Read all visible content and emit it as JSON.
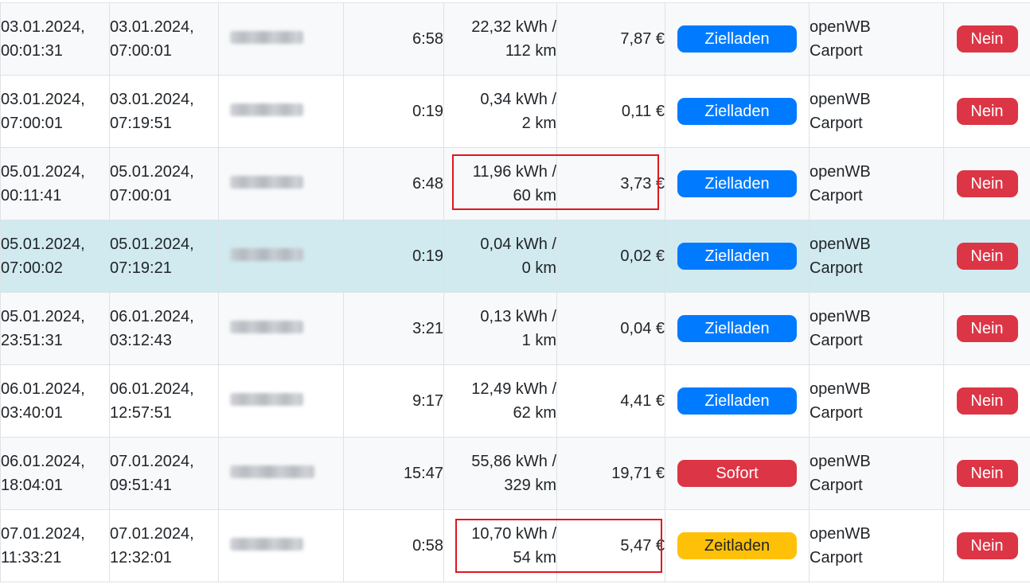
{
  "rows": [
    {
      "start_date": "03.01.2024,",
      "start_time": "00:01:31",
      "end_date": "03.01.2024,",
      "end_time": "07:00:01",
      "duration": "6:58",
      "energy": "22,32 kWh /",
      "range": "112 km",
      "cost": "7,87 €",
      "mode": "Zielladen",
      "mode_color": "#007bff",
      "loc_line1": "openWB",
      "loc_line2": "Carport",
      "flag": "Nein"
    },
    {
      "start_date": "03.01.2024,",
      "start_time": "07:00:01",
      "end_date": "03.01.2024,",
      "end_time": "07:19:51",
      "duration": "0:19",
      "energy": "0,34 kWh /",
      "range": "2 km",
      "cost": "0,11 €",
      "mode": "Zielladen",
      "mode_color": "#007bff",
      "loc_line1": "openWB",
      "loc_line2": "Carport",
      "flag": "Nein"
    },
    {
      "start_date": "05.01.2024,",
      "start_time": "00:11:41",
      "end_date": "05.01.2024,",
      "end_time": "07:00:01",
      "duration": "6:48",
      "energy": "11,96 kWh /",
      "range": "60 km",
      "cost": "3,73 €",
      "mode": "Zielladen",
      "mode_color": "#007bff",
      "loc_line1": "openWB",
      "loc_line2": "Carport",
      "flag": "Nein"
    },
    {
      "start_date": "05.01.2024,",
      "start_time": "07:00:02",
      "end_date": "05.01.2024,",
      "end_time": "07:19:21",
      "duration": "0:19",
      "energy": "0,04 kWh /",
      "range": "0 km",
      "cost": "0,02 €",
      "mode": "Zielladen",
      "mode_color": "#007bff",
      "loc_line1": "openWB",
      "loc_line2": "Carport",
      "flag": "Nein"
    },
    {
      "start_date": "05.01.2024,",
      "start_time": "23:51:31",
      "end_date": "06.01.2024,",
      "end_time": "03:12:43",
      "duration": "3:21",
      "energy": "0,13 kWh /",
      "range": "1 km",
      "cost": "0,04 €",
      "mode": "Zielladen",
      "mode_color": "#007bff",
      "loc_line1": "openWB",
      "loc_line2": "Carport",
      "flag": "Nein"
    },
    {
      "start_date": "06.01.2024,",
      "start_time": "03:40:01",
      "end_date": "06.01.2024,",
      "end_time": "12:57:51",
      "duration": "9:17",
      "energy": "12,49 kWh /",
      "range": "62 km",
      "cost": "4,41 €",
      "mode": "Zielladen",
      "mode_color": "#007bff",
      "loc_line1": "openWB",
      "loc_line2": "Carport",
      "flag": "Nein"
    },
    {
      "start_date": "06.01.2024,",
      "start_time": "18:04:01",
      "end_date": "07.01.2024,",
      "end_time": "09:51:41",
      "duration": "15:47",
      "energy": "55,86 kWh /",
      "range": "329 km",
      "cost": "19,71 €",
      "mode": "Sofort",
      "mode_color": "#dc3545",
      "loc_line1": "openWB",
      "loc_line2": "Carport",
      "flag": "Nein"
    },
    {
      "start_date": "07.01.2024,",
      "start_time": "11:33:21",
      "end_date": "07.01.2024,",
      "end_time": "12:32:01",
      "duration": "0:58",
      "energy": "10,70 kWh /",
      "range": "54 km",
      "cost": "5,47 €",
      "mode": "Zeitladen",
      "mode_color": "#ffc107",
      "loc_line1": "openWB",
      "loc_line2": "Carport",
      "flag": "Nein"
    }
  ],
  "highlight_row": 3,
  "annotation_color": "#e0161e",
  "flag_color": "#dc3545"
}
